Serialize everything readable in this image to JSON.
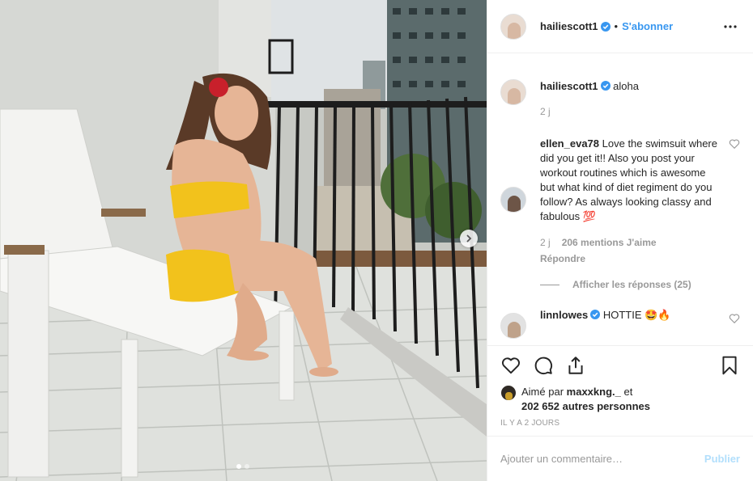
{
  "post": {
    "author": "hailiescott1",
    "separator": "•",
    "follow_label": "S'abonner"
  },
  "comments": [
    {
      "username": "hailiescott1",
      "text": "aloha",
      "time": "2 j",
      "verified": true
    },
    {
      "username": "ellen_eva78",
      "text": "Love the swimsuit where did you get it!! Also you post your workout routines which is awesome but what kind of diet regiment do you follow? As always looking classy and fabulous 💯",
      "time": "2 j",
      "likes": "206 mentions J'aime",
      "reply": "Répondre",
      "view_replies": "Afficher les réponses (25)"
    },
    {
      "username": "linnlowes",
      "text": "HOTTIE 🤩🔥",
      "verified": true
    }
  ],
  "likes": {
    "prefix": "Aimé par",
    "user": "maxxkng._",
    "middle": "et",
    "count": "202 652 autres personnes"
  },
  "time_ago": "IL Y A 2 JOURS",
  "add_comment": {
    "placeholder": "Ajouter un commentaire…",
    "publish_label": "Publier"
  },
  "carousel": {
    "total": 2,
    "current": 1
  },
  "colors": {
    "accent": "#3897f0",
    "publish_disabled": "#b2dffc",
    "swimsuit": "#f2c21c",
    "hair_flower": "#c8202b"
  }
}
